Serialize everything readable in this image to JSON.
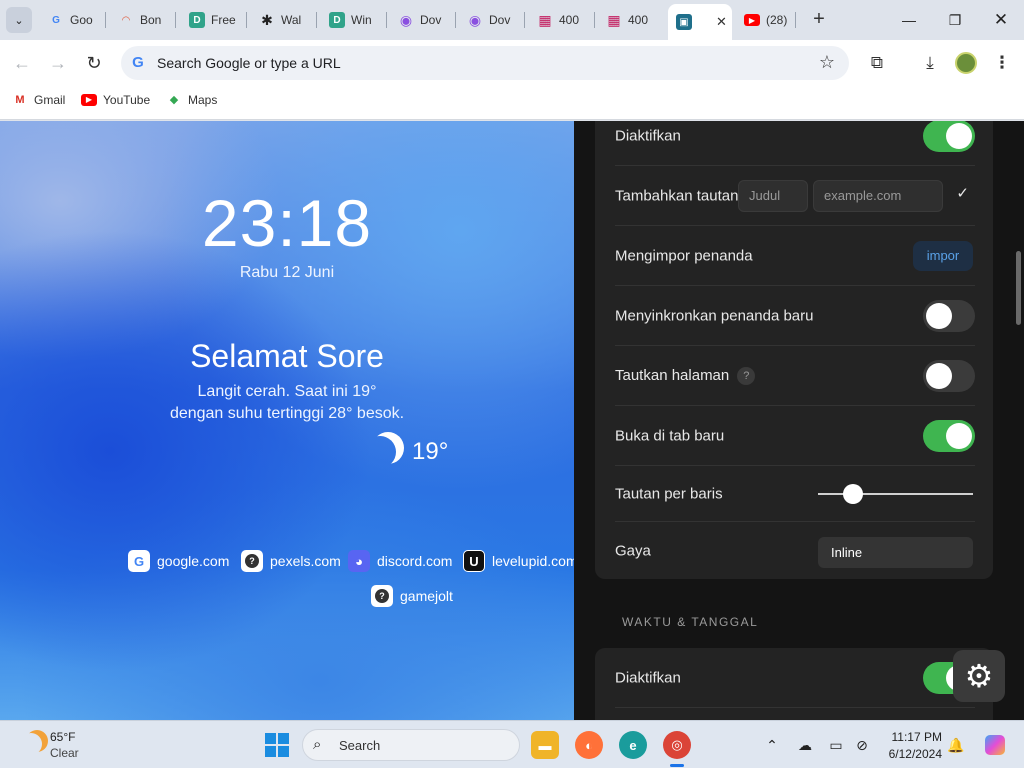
{
  "tabs": [
    {
      "label": "Goo",
      "icon": "G",
      "color": "#4285f4"
    },
    {
      "label": "Bon",
      "icon": "◠",
      "color": "#e05a3a"
    },
    {
      "label": "Free",
      "icon": "D",
      "color": "#30a38a"
    },
    {
      "label": "Wal",
      "icon": "✱",
      "color": "#222222"
    },
    {
      "label": "Win",
      "icon": "D",
      "color": "#30a38a"
    },
    {
      "label": "Dov",
      "icon": "◉",
      "color": "#8a4fe0"
    },
    {
      "label": "Dov",
      "icon": "◉",
      "color": "#8a4fe0"
    },
    {
      "label": "400",
      "icon": "▦",
      "color": "#c2185b"
    },
    {
      "label": "400",
      "icon": "▦",
      "color": "#c2185b"
    },
    {
      "label": "",
      "icon": "▣",
      "color": "#1f6f8b"
    },
    {
      "label": "(28)",
      "icon": "▶",
      "color": "#ff0000"
    }
  ],
  "omnibox": {
    "placeholder": "Search Google or type a URL"
  },
  "bookmarks": [
    {
      "label": "Gmail",
      "icon": "M",
      "color": "#d93025"
    },
    {
      "label": "YouTube",
      "icon": "▶",
      "color": "#ff0000"
    },
    {
      "label": "Maps",
      "icon": "◆",
      "color": "#34a853"
    }
  ],
  "newtab": {
    "clock": "23:18",
    "date": "Rabu 12 Juni",
    "greeting": "Selamat Sore",
    "weather_line1": "Langit cerah. Saat ini 19°",
    "weather_line2": "dengan suhu tertinggi 28° besok.",
    "temp": "19°",
    "quicklinks": [
      {
        "label": "google.com",
        "icon": "G",
        "color": "#4285f4"
      },
      {
        "label": "pexels.com",
        "icon": "?",
        "color": "#333333"
      },
      {
        "label": "discord.com",
        "icon": "◕",
        "color": "#5865f2"
      },
      {
        "label": "levelupid.com",
        "icon": "U",
        "color": "#111111"
      },
      {
        "label": "gamejolt",
        "icon": "?",
        "color": "#333333"
      }
    ]
  },
  "settings": {
    "enabled_label": "Diaktifkan",
    "enabled_on": true,
    "add_link_label": "Tambahkan tautan",
    "title_placeholder": "Judul",
    "url_placeholder": "example.com",
    "check": "✓",
    "import_label": "Mengimpor penanda",
    "import_button": "impor",
    "sync_label": "Menyinkronkan penanda baru",
    "sync_on": false,
    "link_page_label": "Tautkan halaman",
    "link_page_help": "?",
    "link_page_on": false,
    "new_tab_label": "Buka di tab baru",
    "new_tab_on": true,
    "links_per_row_label": "Tautan per baris",
    "style_label": "Gaya",
    "style_value": "Inline",
    "section_time": "WAKTU & TANGGAL",
    "time_enabled_label": "Diaktifkan",
    "time_enabled_on": true
  },
  "taskbar": {
    "temp": "65°F",
    "condition": "Clear",
    "search": "Search",
    "time": "11:17 PM",
    "date": "6/12/2024"
  }
}
